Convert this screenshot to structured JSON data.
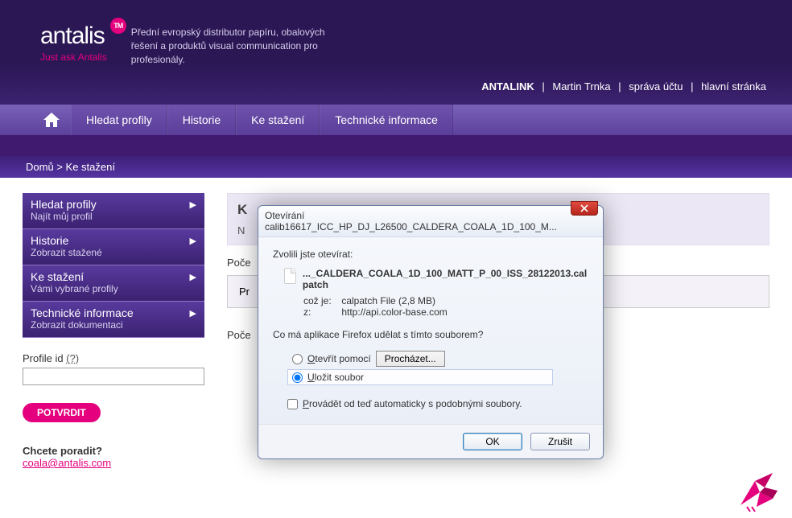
{
  "header": {
    "logo_text": "antalis",
    "logo_badge": "TM",
    "logo_tagline": "Just ask Antalis",
    "tagline": "Přední evropský distributor papíru, obalových řešení a produktů visual communication pro profesionály."
  },
  "topnav": {
    "brand": "ANTALINK",
    "user": "Martin Trnka",
    "link_account": "správa účtu",
    "link_home": "hlavní stránka",
    "sep": " | "
  },
  "mainnav": {
    "items": [
      "Hledat profily",
      "Historie",
      "Ke stažení",
      "Technické informace"
    ]
  },
  "breadcrumb": {
    "home": "Domů",
    "sep": " > ",
    "current": "Ke stažení"
  },
  "sidebar": {
    "items": [
      {
        "title": "Hledat profily",
        "sub": "Najít můj profil"
      },
      {
        "title": "Historie",
        "sub": "Zobrazit stažené"
      },
      {
        "title": "Ke stažení",
        "sub": "Vámi vybrané profily"
      },
      {
        "title": "Technické informace",
        "sub": "Zobrazit dokumentaci"
      }
    ],
    "profile_id_label": "Profile id",
    "profile_id_help": "(?)",
    "confirm_btn": "POTVRDIT",
    "help_title": "Chcete poradit?",
    "help_email": "coala@antalis.com"
  },
  "main": {
    "header_big": "K",
    "header_line2": "N",
    "count1_label": "Poče",
    "box_label": "Pr",
    "count2_label": "Poče"
  },
  "dialog": {
    "title": "Otevírání calib16617_ICC_HP_DJ_L26500_CALDERA_COALA_1D_100_M...",
    "chosen": "Zvolili jste otevírat:",
    "file_name": "..._CALDERA_COALA_1D_100_MATT_P_00_ISS_28122013.calpatch",
    "which_key": "což je:",
    "which_val": "calpatch File (2,8 MB)",
    "from_key": "z:",
    "from_val": "http://api.color-base.com",
    "question": "Co má aplikace Firefox udělat s tímto souborem?",
    "opt_open": "Otevřít pomocí",
    "browse": "Procházet...",
    "opt_save": "Uložit soubor",
    "auto": "Provádět od teď automaticky s podobnými soubory.",
    "ok": "OK",
    "cancel": "Zrušit"
  }
}
